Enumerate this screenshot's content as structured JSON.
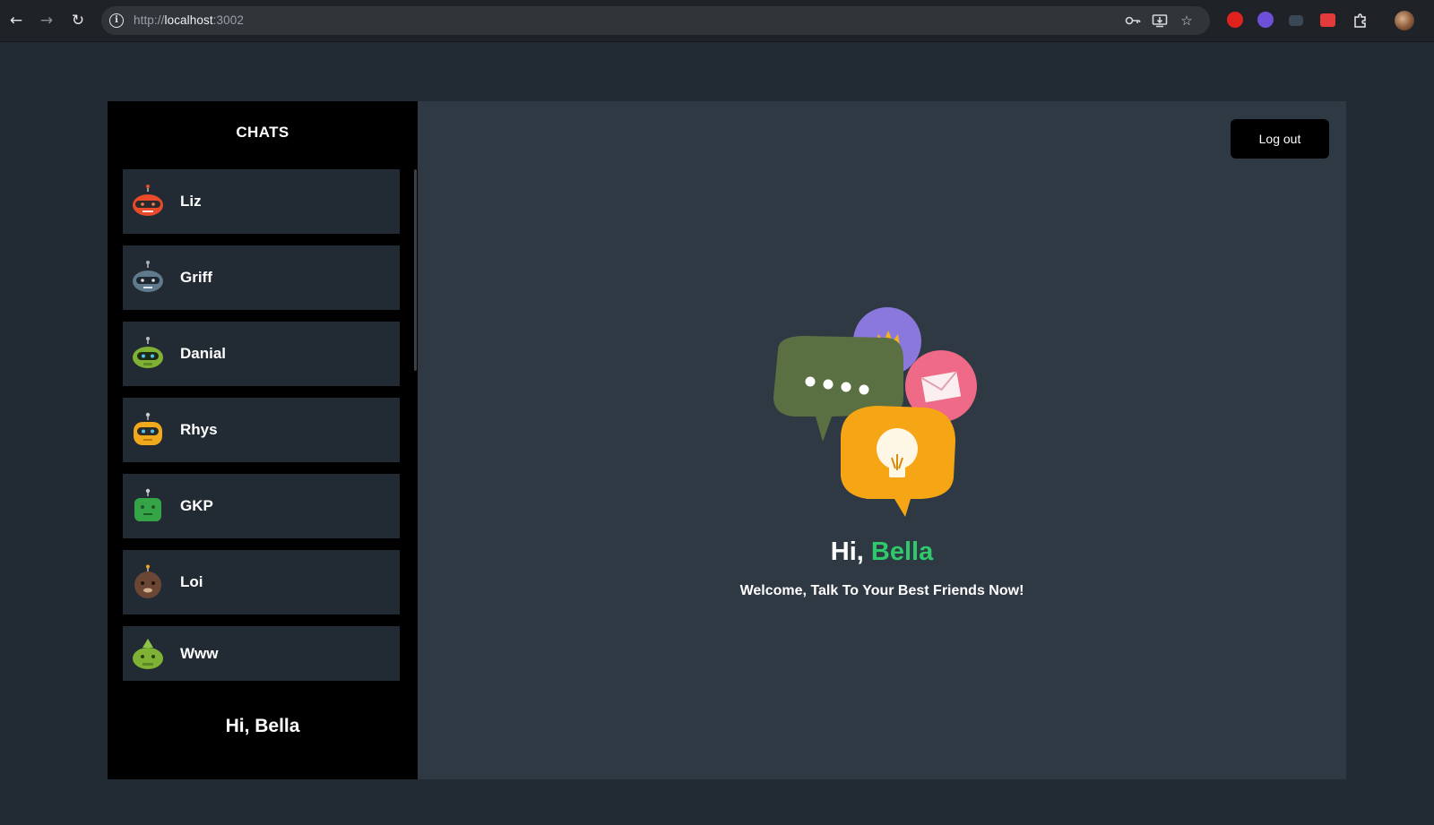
{
  "browser": {
    "url_proto": "http://",
    "url_host": "localhost",
    "url_port": ":3002"
  },
  "sidebar": {
    "title": "CHATS",
    "chats": [
      {
        "name": "Liz",
        "color": "#e84a2a"
      },
      {
        "name": "Griff",
        "color": "#5f7a8c"
      },
      {
        "name": "Danial",
        "color": "#7fb135"
      },
      {
        "name": "Rhys",
        "color": "#f0a81c"
      },
      {
        "name": "GKP",
        "color": "#35a447"
      },
      {
        "name": "Loi",
        "color": "#6b4634"
      },
      {
        "name": "Www",
        "color": "#7fb135"
      }
    ],
    "greeting": "Hi, Bella"
  },
  "main": {
    "logout_label": "Log out",
    "hi": "Hi,",
    "user_name": "Bella",
    "subtitle": "Welcome, Talk To Your Best Friends Now!"
  },
  "colors": {
    "accent_green": "#2fc86b",
    "sidebar_bg": "#000000",
    "main_bg": "#2e3943"
  }
}
